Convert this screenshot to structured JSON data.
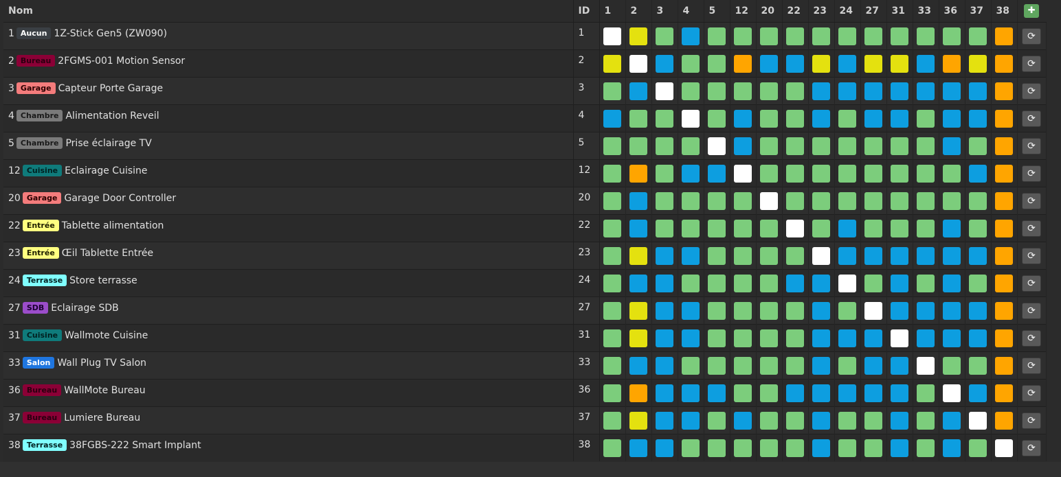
{
  "header": {
    "name_label": "Nom",
    "id_label": "ID",
    "columns": [
      "1",
      "2",
      "3",
      "4",
      "5",
      "12",
      "20",
      "22",
      "23",
      "24",
      "27",
      "31",
      "33",
      "36",
      "37",
      "38"
    ]
  },
  "colors": {
    "G": "#7ccd7c",
    "B": "#0d9ee0",
    "Y": "#e4e10f",
    "O": "#ffa500",
    "W": "#ffffff"
  },
  "locations": {
    "Aucun": {
      "bg": "#3a3f44",
      "fg": "#ffffff"
    },
    "Bureau": {
      "bg": "#8b0036",
      "fg": "#2a0010"
    },
    "Garage": {
      "bg": "#f47c7c",
      "fg": "#2b0000"
    },
    "Chambre": {
      "bg": "#7a7a7a",
      "fg": "#1a1a1a"
    },
    "Cuisine": {
      "bg": "#0f7b7b",
      "fg": "#002020"
    },
    "Entrée": {
      "bg": "#ffff80",
      "fg": "#202000"
    },
    "Terrasse": {
      "bg": "#80ffff",
      "fg": "#002020"
    },
    "SDB": {
      "bg": "#9b4dca",
      "fg": "#1a0030"
    },
    "Salon": {
      "bg": "#1f76e0",
      "fg": "#ffffff"
    }
  },
  "rows": [
    {
      "num": "1",
      "location": "Aucun",
      "name": "1Z-Stick Gen5 (ZW090)",
      "id": "1",
      "cells": "WYGBGGGGGGGGGGGO"
    },
    {
      "num": "2",
      "location": "Bureau",
      "name": "2FGMS-001 Motion Sensor",
      "id": "2",
      "cells": "YWBGGOBBYBYYBOYO"
    },
    {
      "num": "3",
      "location": "Garage",
      "name": "Capteur Porte Garage",
      "id": "3",
      "cells": "GBWGGGGGBBBBBBBO"
    },
    {
      "num": "4",
      "location": "Chambre",
      "name": "Alimentation Reveil",
      "id": "4",
      "cells": "BGGWGBGGBGBBGBBO"
    },
    {
      "num": "5",
      "location": "Chambre",
      "name": "Prise éclairage TV",
      "id": "5",
      "cells": "GGGGWBGGGGGGGBGO"
    },
    {
      "num": "12",
      "location": "Cuisine",
      "name": "Eclairage Cuisine",
      "id": "12",
      "cells": "GOGBBWGGGGGGGGBO"
    },
    {
      "num": "20",
      "location": "Garage",
      "name": "Garage Door Controller",
      "id": "20",
      "cells": "GBGGGGWGGGGGGGGO"
    },
    {
      "num": "22",
      "location": "Entrée",
      "name": "Tablette alimentation",
      "id": "22",
      "cells": "GBGGGGGWGBGGGBGO"
    },
    {
      "num": "23",
      "location": "Entrée",
      "name": "Œil Tablette Entrée",
      "id": "23",
      "cells": "GYBBGGGGWBBBBBBO"
    },
    {
      "num": "24",
      "location": "Terrasse",
      "name": "Store terrasse",
      "id": "24",
      "cells": "GBBGGGGBBWGBGBGO"
    },
    {
      "num": "27",
      "location": "SDB",
      "name": "Eclairage SDB",
      "id": "27",
      "cells": "GYBBGGGGBGWBBBBO"
    },
    {
      "num": "31",
      "location": "Cuisine",
      "name": "Wallmote Cuisine",
      "id": "31",
      "cells": "GYBBGGGGBBBWBBBO"
    },
    {
      "num": "33",
      "location": "Salon",
      "name": "Wall Plug TV Salon",
      "id": "33",
      "cells": "GBBGGGGGBGBBWGGO"
    },
    {
      "num": "36",
      "location": "Bureau",
      "name": "WallMote Bureau",
      "id": "36",
      "cells": "GOBBBGGBBBBBGWBO"
    },
    {
      "num": "37",
      "location": "Bureau",
      "name": "Lumiere Bureau",
      "id": "37",
      "cells": "GYBBGBGGBGGBGBWO"
    },
    {
      "num": "38",
      "location": "Terrasse",
      "name": "38FGBS-222 Smart Implant",
      "id": "38",
      "cells": "GBBGGGGGBGGBGBGW"
    }
  ],
  "icons": {
    "heal_icon": "✚",
    "refresh_icon": "⟳"
  }
}
